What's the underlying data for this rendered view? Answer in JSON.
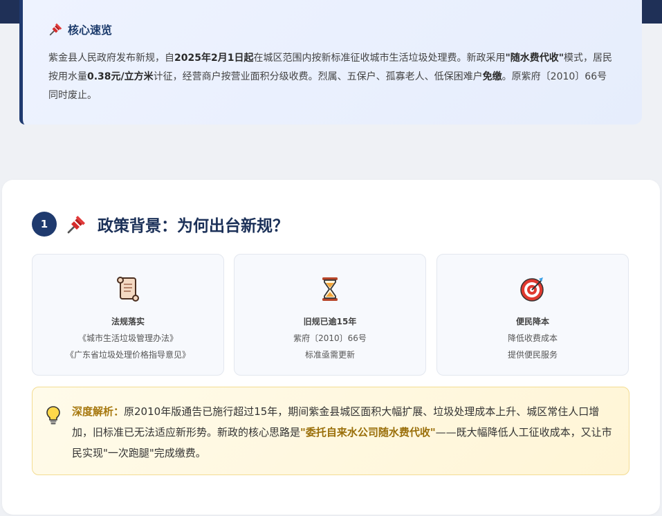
{
  "summary": {
    "title": "核心速览",
    "t1": "紫金县人民政府发布新规，自",
    "b1": "2025年2月1日起",
    "t2": "在城区范围内按新标准征收城市生活垃圾处理费。新政采用",
    "b2": "\"随水费代收\"",
    "t3": "模式，居民按用水量",
    "b3": "0.38元/立方米",
    "t4": "计征，经营商户按营业面积分级收费。烈属、五保户、孤寡老人、低保困难户",
    "b4": "免缴",
    "t5": "。原紫府〔2010〕66号同时废止。"
  },
  "section": {
    "number": "1",
    "title": "政策背景：为何出台新规？"
  },
  "features": [
    {
      "icon": "scroll-icon",
      "title": "法规落实",
      "line1": "《城市生活垃圾管理办法》",
      "line2": "《广东省垃圾处理价格指导意见》"
    },
    {
      "icon": "hourglass-icon",
      "title": "旧规已逾15年",
      "line1": "紫府〔2010〕66号",
      "line2": "标准亟需更新"
    },
    {
      "icon": "target-icon",
      "title": "便民降本",
      "line1": "降低收费成本",
      "line2": "提供便民服务"
    }
  ],
  "insight": {
    "label": "深度解析：",
    "t1": "原2010年版通告已施行超过15年，期间紫金县城区面积大幅扩展、垃圾处理成本上升、城区常住人口增加，旧标准已无法适应新形势。新政的核心思路是",
    "strong": "\"委托自来水公司随水费代收\"",
    "t2": "——既大幅降低人工征收成本，又让市民实现\"一次跑腿\"完成缴费。"
  },
  "colors": {
    "navy": "#1f3057",
    "accent": "#1f3a6e",
    "insight_label": "#a6770d"
  }
}
